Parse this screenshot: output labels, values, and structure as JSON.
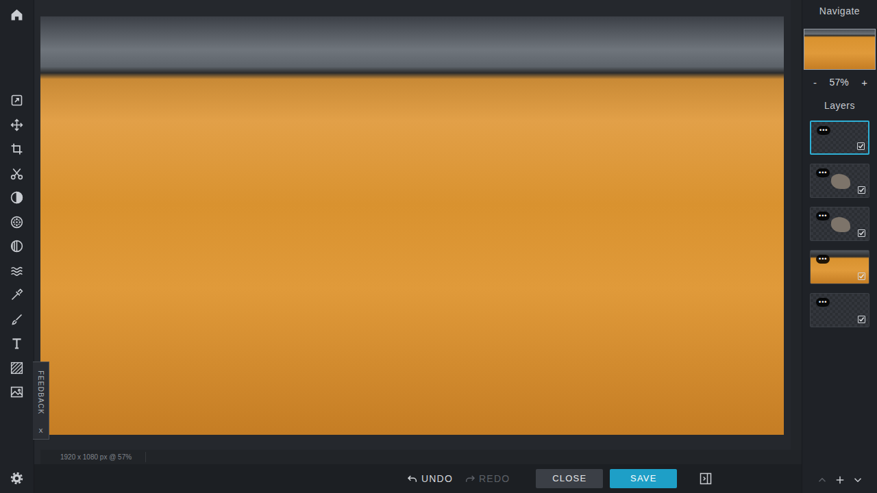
{
  "navigator": {
    "title": "Navigate",
    "zoom_out": "-",
    "zoom": "57%",
    "zoom_in": "+"
  },
  "layers": {
    "title": "Layers",
    "items": [
      {
        "menu": "•••",
        "kind": "empty",
        "visible": true,
        "selected": true
      },
      {
        "menu": "•••",
        "kind": "sprite",
        "visible": true,
        "selected": false
      },
      {
        "menu": "•••",
        "kind": "sprite",
        "visible": true,
        "selected": false
      },
      {
        "menu": "•••",
        "kind": "photo",
        "visible": true,
        "selected": false
      },
      {
        "menu": "•••",
        "kind": "empty",
        "visible": true,
        "selected": false
      }
    ]
  },
  "canvas": {
    "info": "1920 x 1080 px @ 57%"
  },
  "feedback": {
    "label": "FEEDBACK",
    "close": "X"
  },
  "actions": {
    "undo": {
      "label": "UNDO",
      "disabled": false
    },
    "redo": {
      "label": "REDO",
      "disabled": true
    },
    "close": "CLOSE",
    "save": "SAVE"
  }
}
